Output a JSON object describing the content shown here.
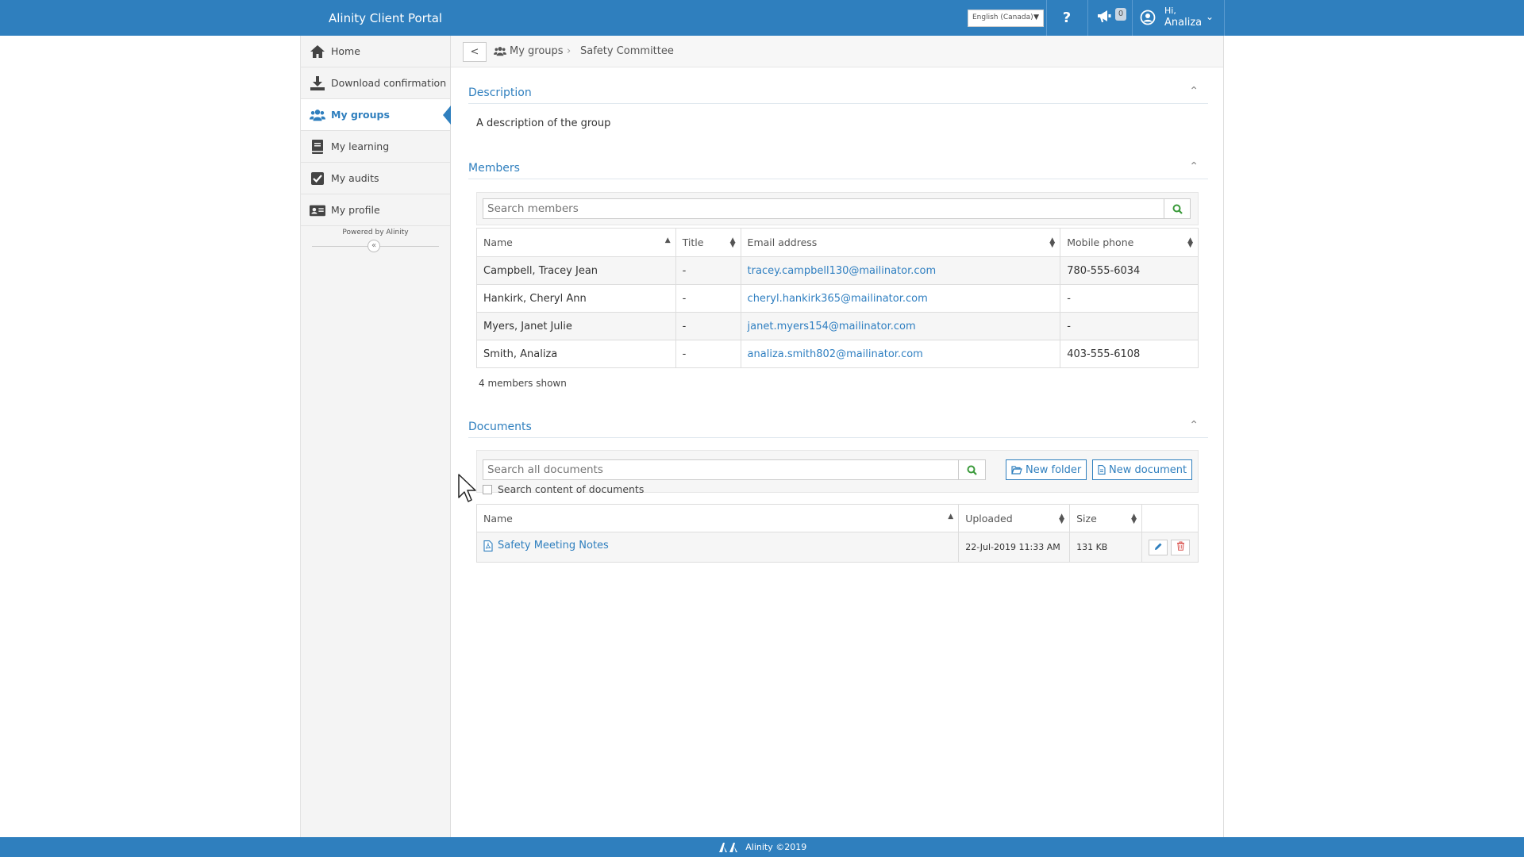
{
  "app": {
    "title": "Alinity Client Portal"
  },
  "header": {
    "language": "English (Canada)",
    "help_label": "?",
    "notification_count": "0",
    "greeting": "Hi,",
    "user_name": "Analiza"
  },
  "sidebar": {
    "items": [
      {
        "label": "Home",
        "icon": "home-icon"
      },
      {
        "label": "Download confirmation",
        "icon": "download-icon"
      },
      {
        "label": "My groups",
        "icon": "users-icon",
        "active": true
      },
      {
        "label": "My learning",
        "icon": "book-icon"
      },
      {
        "label": "My audits",
        "icon": "checkbox-icon"
      },
      {
        "label": "My profile",
        "icon": "id-card-icon"
      }
    ],
    "powered_by": "Powered by Alinity",
    "collapse_label": "«"
  },
  "breadcrumb": {
    "back_label": "<",
    "parent": "My groups",
    "separator": "›",
    "current": "Safety Committee"
  },
  "description": {
    "title": "Description",
    "text": "A description of the group"
  },
  "members": {
    "title": "Members",
    "search_placeholder": "Search members",
    "columns": [
      "Name",
      "Title",
      "Email address",
      "Mobile phone"
    ],
    "rows": [
      {
        "name": "Campbell, Tracey Jean",
        "title": "-",
        "email": "tracey.campbell130@mailinator.com",
        "phone": "780-555-6034"
      },
      {
        "name": "Hankirk, Cheryl Ann",
        "title": "-",
        "email": "cheryl.hankirk365@mailinator.com",
        "phone": "-"
      },
      {
        "name": "Myers, Janet Julie",
        "title": "-",
        "email": "janet.myers154@mailinator.com",
        "phone": "-"
      },
      {
        "name": "Smith, Analiza",
        "title": "-",
        "email": "analiza.smith802@mailinator.com",
        "phone": "403-555-6108"
      }
    ],
    "count_text": "4 members shown"
  },
  "documents": {
    "title": "Documents",
    "search_placeholder": "Search all documents",
    "new_folder_label": "New folder",
    "new_document_label": "New document",
    "search_content_label": "Search content of documents",
    "columns": [
      "Name",
      "Uploaded",
      "Size"
    ],
    "rows": [
      {
        "name": "Safety Meeting Notes",
        "uploaded": "22-Jul-2019 11:33 AM",
        "size": "131 KB"
      }
    ]
  },
  "footer": {
    "text": "Alinity ©2019"
  },
  "colors": {
    "brand": "#2f7fbe",
    "link": "#2f7fc1",
    "delete": "#d9534f",
    "search_icon": "#3a9a3a"
  }
}
